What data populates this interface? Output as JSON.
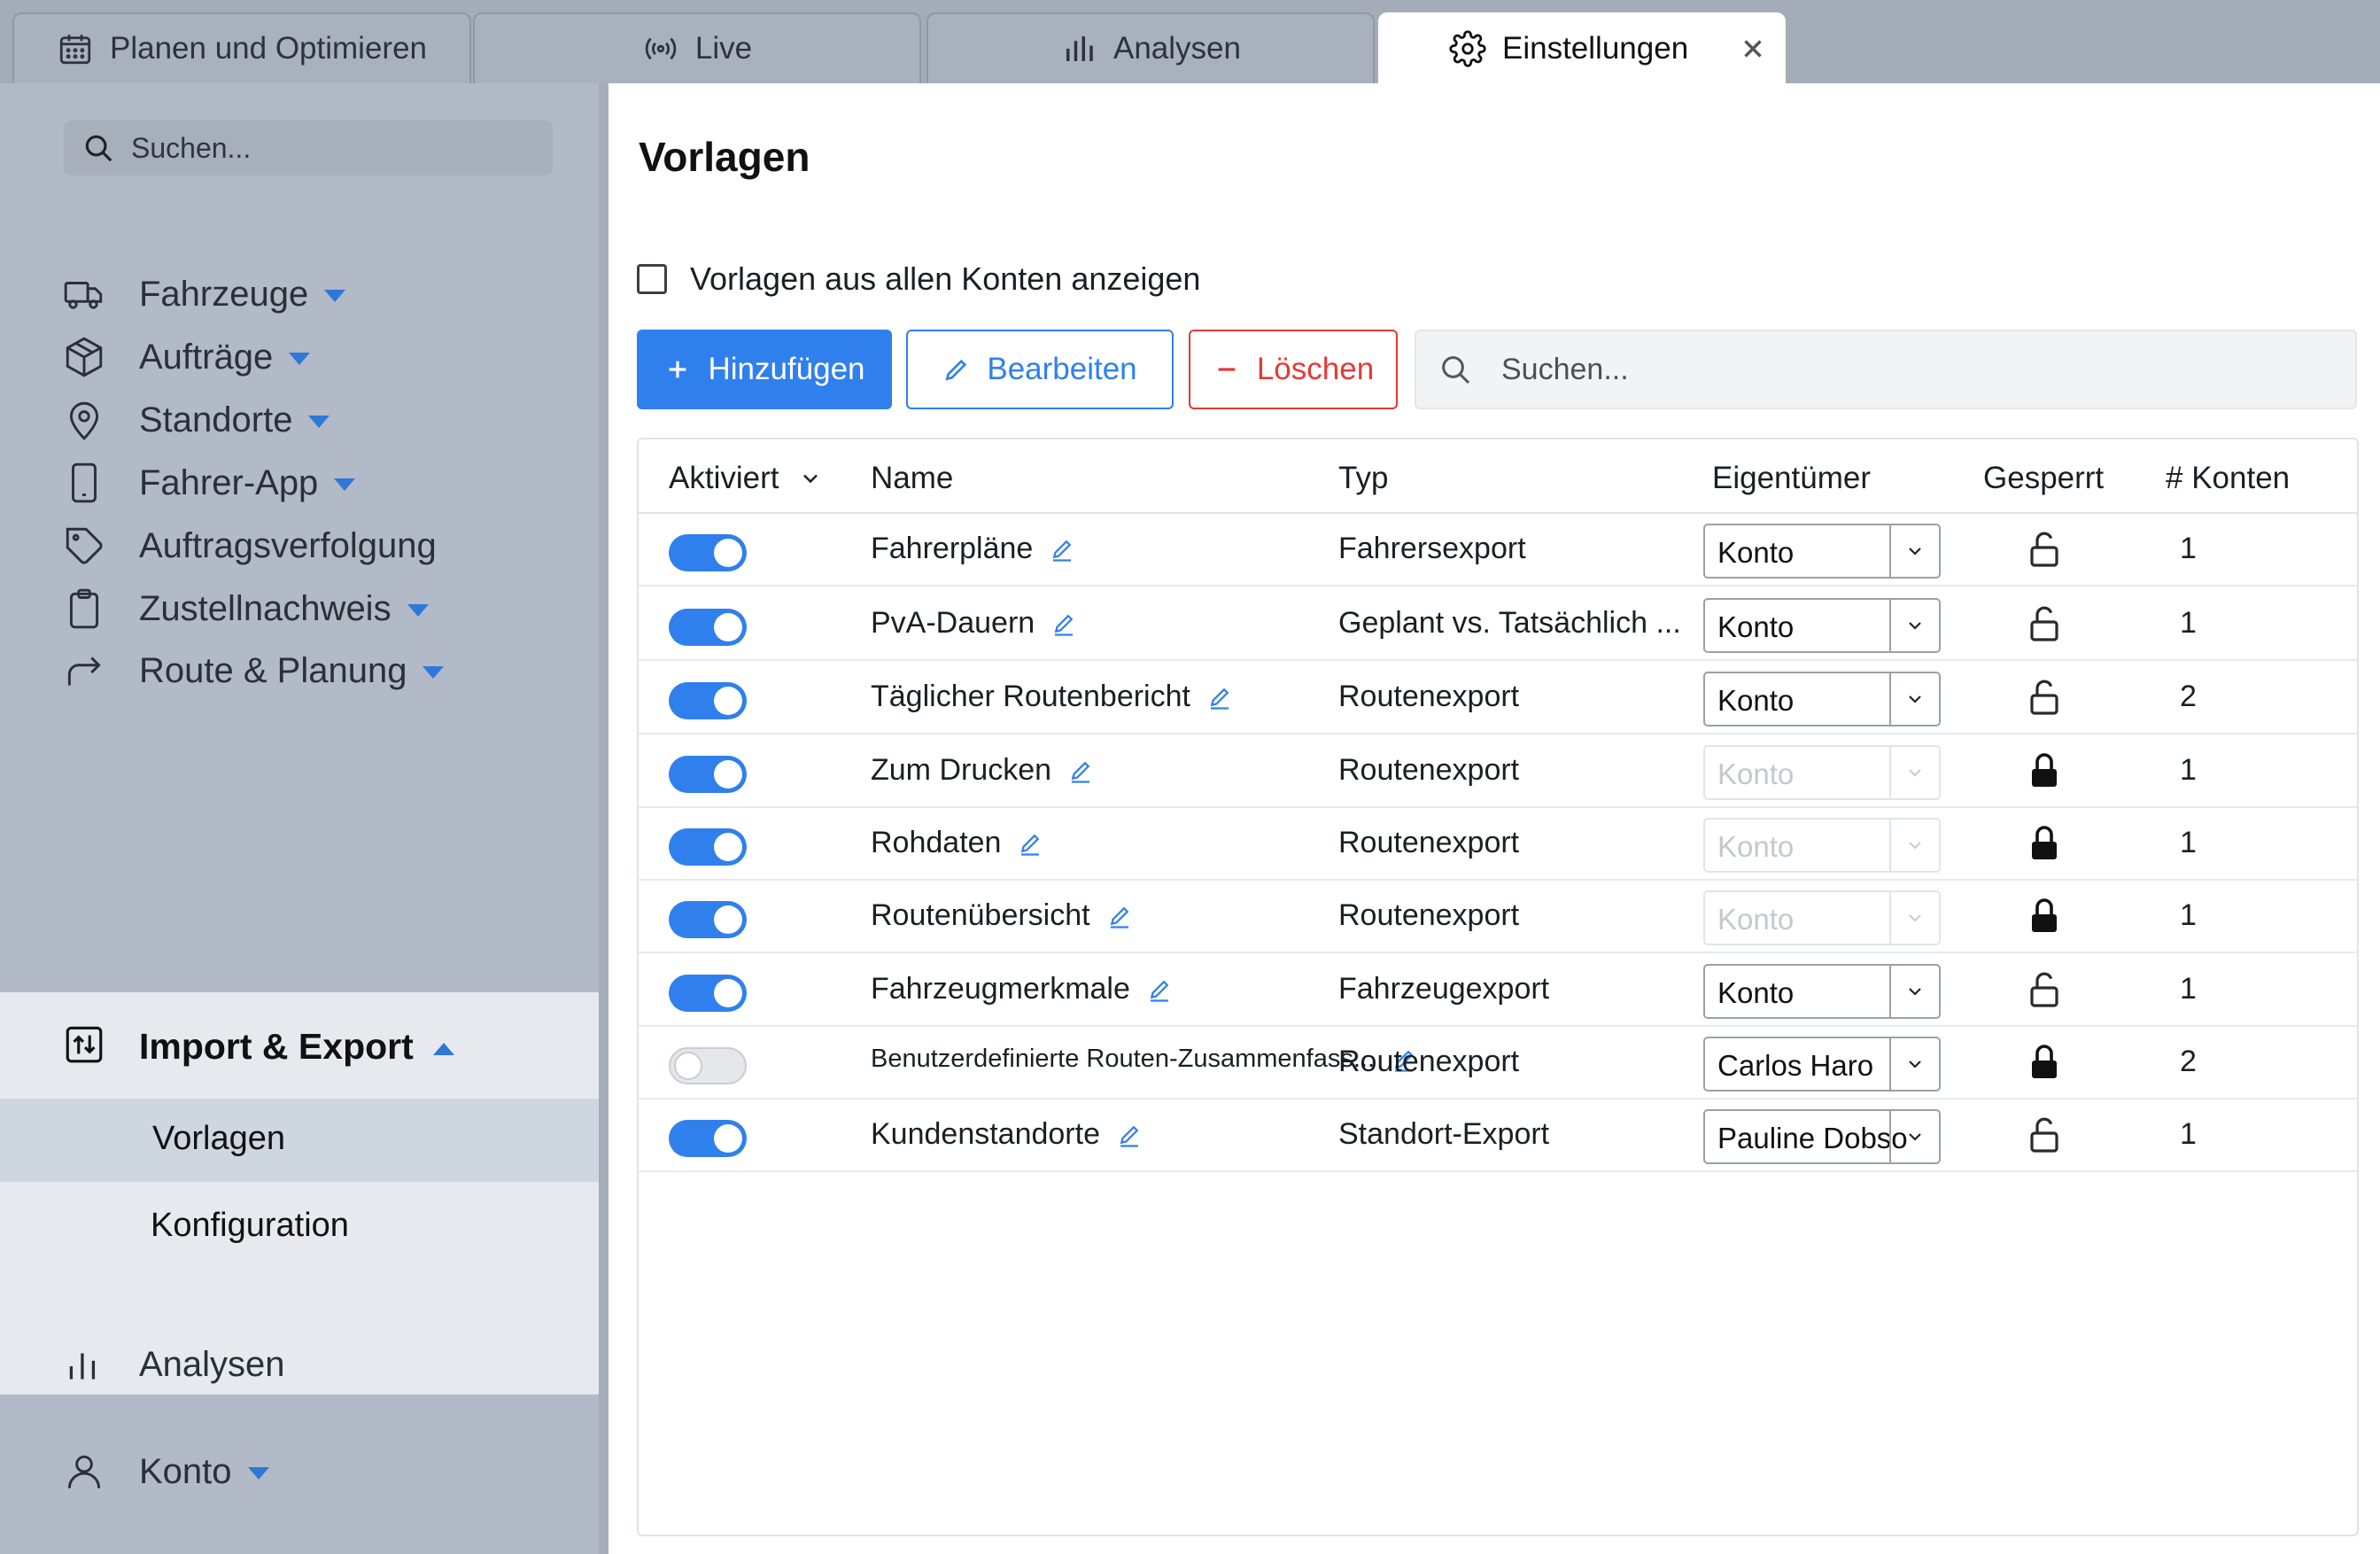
{
  "tabs": [
    {
      "label": "Planen und Optimieren",
      "icon": "calendar-icon"
    },
    {
      "label": "Live",
      "icon": "broadcast-icon"
    },
    {
      "label": "Analysen",
      "icon": "bar-chart-icon"
    },
    {
      "label": "Einstellungen",
      "icon": "gear-icon",
      "active": true
    }
  ],
  "sidebar": {
    "search_placeholder": "Suchen...",
    "items": [
      {
        "label": "Fahrzeuge",
        "icon": "truck-icon",
        "expandable": true
      },
      {
        "label": "Aufträge",
        "icon": "package-icon",
        "expandable": true
      },
      {
        "label": "Standorte",
        "icon": "map-pin-icon",
        "expandable": true
      },
      {
        "label": "Fahrer-App",
        "icon": "phone-icon",
        "expandable": true
      },
      {
        "label": "Auftragsverfolgung",
        "icon": "tag-icon",
        "expandable": false
      },
      {
        "label": "Zustellnachweis",
        "icon": "clipboard-icon",
        "expandable": true
      },
      {
        "label": "Route & Planung",
        "icon": "share-arrow-icon",
        "expandable": true
      }
    ],
    "import_export": {
      "label": "Import & Export",
      "icon": "import-export-icon",
      "sub_items": [
        "Vorlagen",
        "Konfiguration"
      ],
      "selected": "Vorlagen"
    },
    "bottom_items": [
      {
        "label": "Analysen",
        "icon": "bar-chart-icon",
        "expandable": false
      },
      {
        "label": "Konto",
        "icon": "user-icon",
        "expandable": true
      }
    ]
  },
  "main": {
    "title": "Vorlagen",
    "show_all_label": "Vorlagen aus allen Konten anzeigen",
    "buttons": {
      "add": "Hinzufügen",
      "edit": "Bearbeiten",
      "delete": "Löschen"
    },
    "search_placeholder": "Suchen...",
    "columns": [
      "Aktiviert",
      "Name",
      "Typ",
      "Eigentümer",
      "Gesperrt",
      "# Konten"
    ],
    "rows": [
      {
        "enabled": true,
        "name": "Fahrerpläne",
        "type": "Fahrersexport",
        "owner": "Konto",
        "owner_disabled": false,
        "locked": false,
        "accounts": "1"
      },
      {
        "enabled": true,
        "name": "PvA-Dauern",
        "type": "Geplant vs. Tatsächlich ...",
        "owner": "Konto",
        "owner_disabled": false,
        "locked": false,
        "accounts": "1"
      },
      {
        "enabled": true,
        "name": "Täglicher Routenbericht",
        "type": "Routenexport",
        "owner": "Konto",
        "owner_disabled": false,
        "locked": false,
        "accounts": "2"
      },
      {
        "enabled": true,
        "name": "Zum Drucken",
        "type": "Routenexport",
        "owner": "Konto",
        "owner_disabled": true,
        "locked": true,
        "accounts": "1"
      },
      {
        "enabled": true,
        "name": "Rohdaten",
        "type": "Routenexport",
        "owner": "Konto",
        "owner_disabled": true,
        "locked": true,
        "accounts": "1"
      },
      {
        "enabled": true,
        "name": "Routenübersicht",
        "type": "Routenexport",
        "owner": "Konto",
        "owner_disabled": true,
        "locked": true,
        "accounts": "1"
      },
      {
        "enabled": true,
        "name": "Fahrzeugmerkmale",
        "type": "Fahrzeugexport",
        "owner": "Konto",
        "owner_disabled": false,
        "locked": false,
        "accounts": "1"
      },
      {
        "enabled": false,
        "name": "Benutzerdefinierte Routen-Zusammenfass...",
        "type": "Routenexport",
        "owner": "Carlos Haro",
        "owner_disabled": false,
        "locked": true,
        "accounts": "2"
      },
      {
        "enabled": true,
        "name": "Kundenstandorte",
        "type": "Standort-Export",
        "owner": "Pauline Dobso",
        "owner_disabled": false,
        "locked": false,
        "accounts": "1"
      }
    ]
  },
  "colors": {
    "accent": "#2f80ed",
    "danger": "#e53935"
  }
}
